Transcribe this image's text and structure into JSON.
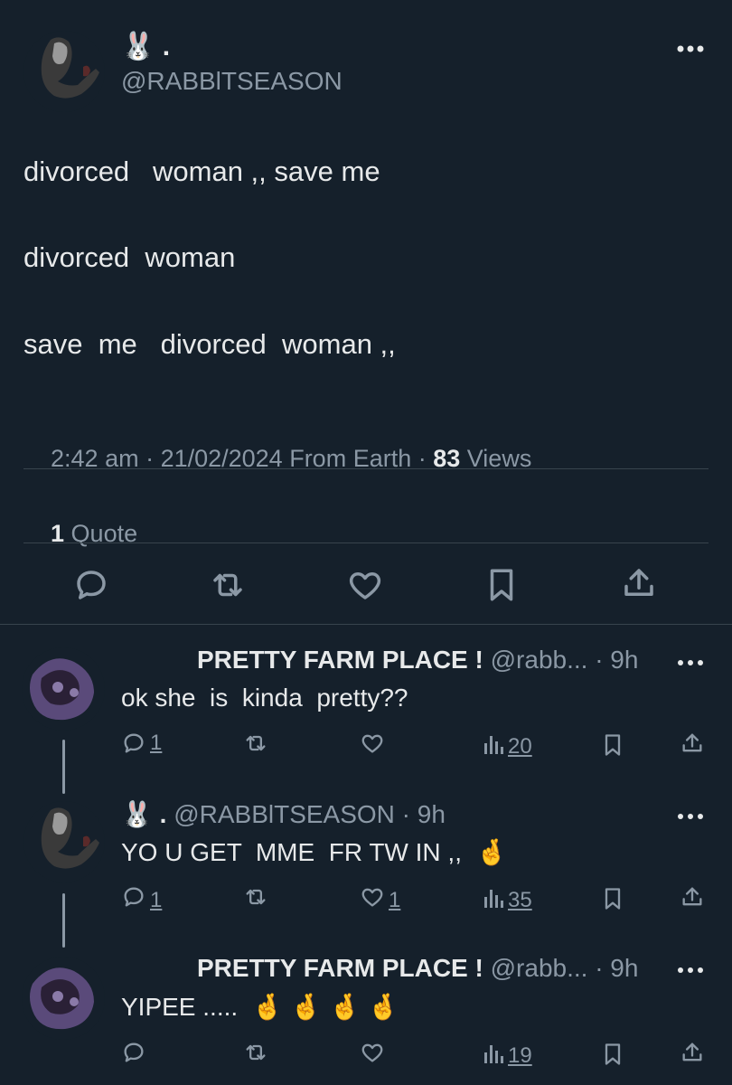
{
  "main_tweet": {
    "display_name": "🐰 .",
    "handle": "@RABBlTSEASON",
    "lines": [
      "divorced   woman ,, save me",
      "divorced  woman",
      "save  me   divorced  woman ,,"
    ],
    "meta_time": "2:42 am · 21/02/2024 From Earth · ",
    "views_count": "83",
    "views_label": " Views",
    "quote_count": "1",
    "quote_label": " Quote"
  },
  "replies": [
    {
      "display_name": "PRETTY FARM PLACE !",
      "handle": "@rabb... · 9h",
      "text": "ok she  is  kinda  pretty??",
      "replies": "1",
      "retweets": "",
      "likes": "",
      "views": "20"
    },
    {
      "display_name": "🐰 .",
      "handle": "@RABBlTSEASON · 9h",
      "text": "YO U GET  MME  FR TW IN ,,  🤞",
      "replies": "1",
      "retweets": "",
      "likes": "1",
      "views": "35"
    },
    {
      "display_name": "PRETTY FARM PLACE !",
      "handle": "@rabb... · 9h",
      "text": "YIPEE .....  🤞 🤞 🤞 🤞",
      "replies": "",
      "retweets": "",
      "likes": "",
      "views": "19"
    }
  ],
  "colors": {
    "background": "#15202b",
    "text": "#e7e9ea",
    "muted": "#8b98a5",
    "divider": "#38444d"
  },
  "icons": {
    "more": "more-horizontal-icon",
    "reply": "reply-bubble-icon",
    "retweet": "retweet-icon",
    "like": "heart-icon",
    "bookmark": "bookmark-icon",
    "share": "share-upload-icon",
    "views": "views-bar-chart-icon"
  }
}
